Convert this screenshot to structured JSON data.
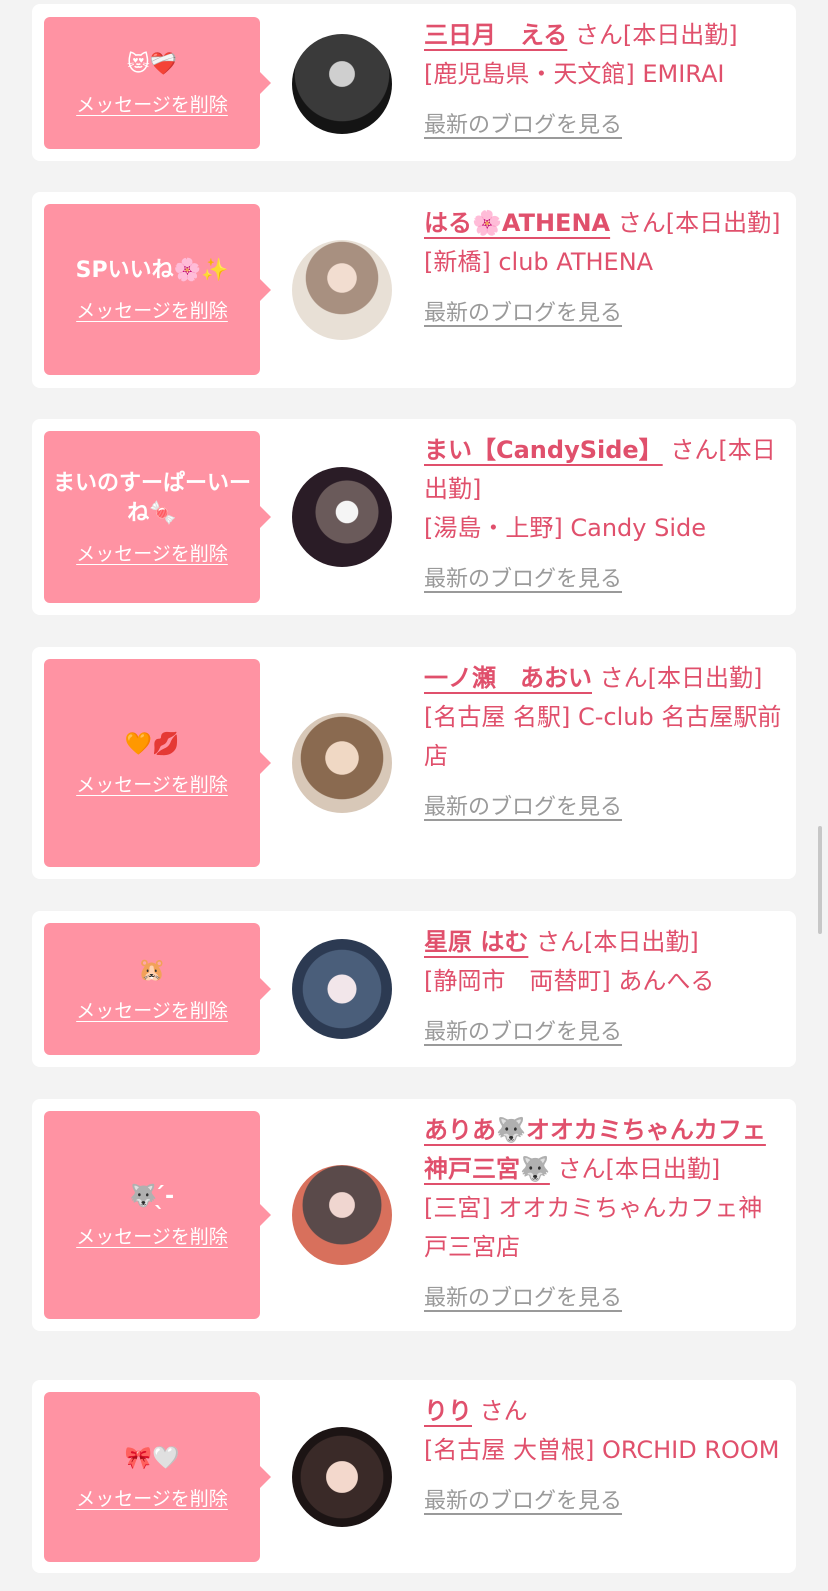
{
  "common": {
    "delete_label": "メッセージを削除",
    "blog_label": "最新のブログを見る"
  },
  "colors": {
    "accent": "#e0506c",
    "message_bg": "#ff93a3",
    "page_bg": "#f3f3f3"
  },
  "items": [
    {
      "message": "😻❤️‍🩹",
      "name": "三日月　える",
      "status": "さん[本日出勤]",
      "shop": "[鹿児島県・天文館] EMIRAI"
    },
    {
      "message": "SPいいね🌸✨",
      "name": "はる🌸ATHENA",
      "status": "さん[本日出勤]",
      "shop": "[新橋] club ATHENA"
    },
    {
      "message": "まいのすーぱーいーね🍬",
      "name": "まい【CandySide】",
      "status": "さん[本日出勤]",
      "shop": "[湯島・上野] Candy Side"
    },
    {
      "message": "🧡💋",
      "name": "一ノ瀬　あおい",
      "status": "さん[本日出勤]",
      "shop": "[名古屋 名駅] C-club 名古屋駅前店"
    },
    {
      "message": "🐹",
      "name": "星原 はむ",
      "status": "さん[本日出勤]",
      "shop": "[静岡市　両替町] あんへる"
    },
    {
      "message": "🐺 ̖́-",
      "name": "ありあ🐺オオカミちゃんカフェ神戸三宮🐺",
      "status": "さん[本日出勤]",
      "shop": "[三宮] オオカミちゃんカフェ神戸三宮店"
    },
    {
      "message": "🎀🤍",
      "name": "りり",
      "status": "さん",
      "shop": "[名古屋 大曽根] ORCHID ROOM"
    }
  ]
}
